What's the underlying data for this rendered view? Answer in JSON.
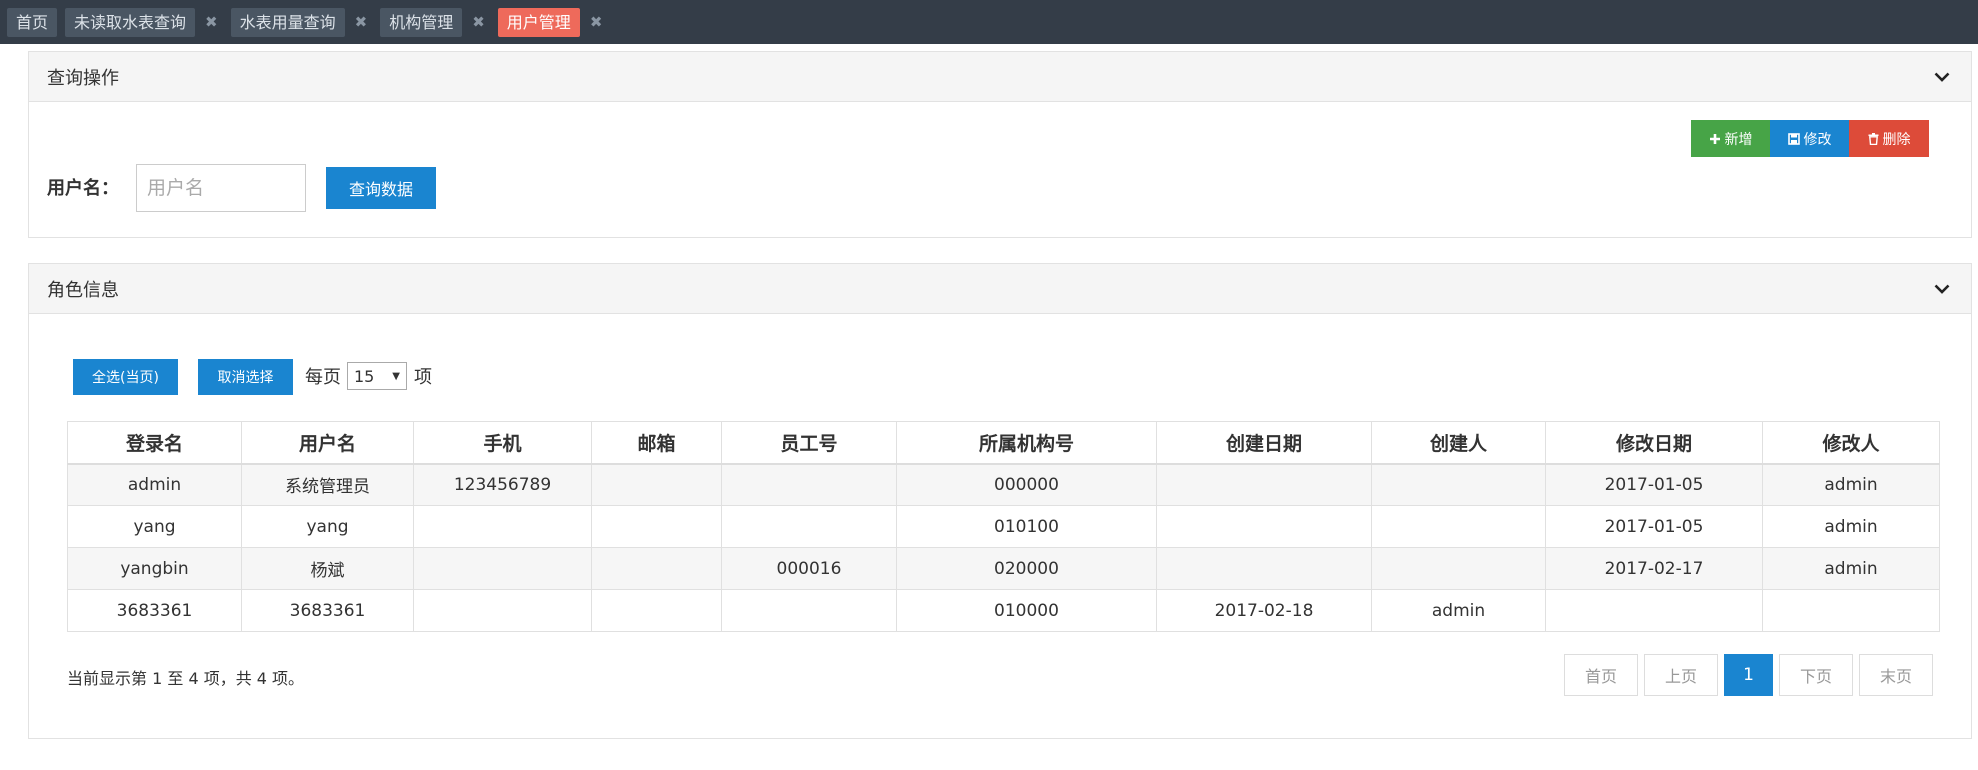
{
  "tabs": {
    "home": "首页",
    "items": [
      {
        "label": "未读取水表查询",
        "active": false
      },
      {
        "label": "水表用量查询",
        "active": false
      },
      {
        "label": "机构管理",
        "active": false
      },
      {
        "label": "用户管理",
        "active": true
      }
    ],
    "close_glyph": "✖"
  },
  "query_panel": {
    "title": "查询操作",
    "username_label": "用户名：",
    "username_placeholder": "用户名",
    "username_value": "",
    "query_button": "查询数据",
    "add_button": "新增",
    "edit_button": "修改",
    "delete_button": "删除"
  },
  "role_panel": {
    "title": "角色信息",
    "select_all_button": "全选(当页)",
    "cancel_select_button": "取消选择",
    "per_page_prefix": "每页",
    "per_page_value": "15",
    "per_page_suffix": "项",
    "summary": "当前显示第 1 至 4 项，共 4 项。"
  },
  "table": {
    "headers": [
      "登录名",
      "用户名",
      "手机",
      "邮箱",
      "员工号",
      "所属机构号",
      "创建日期",
      "创建人",
      "修改日期",
      "修改人"
    ],
    "rows": [
      [
        "admin",
        "系统管理员",
        "123456789",
        "",
        "",
        "000000",
        "",
        "",
        "2017-01-05",
        "admin"
      ],
      [
        "yang",
        "yang",
        "",
        "",
        "",
        "010100",
        "",
        "",
        "2017-01-05",
        "admin"
      ],
      [
        "yangbin",
        "杨斌",
        "",
        "",
        "000016",
        "020000",
        "",
        "",
        "2017-02-17",
        "admin"
      ],
      [
        "3683361",
        "3683361",
        "",
        "",
        "",
        "010000",
        "2017-02-18",
        "admin",
        "",
        ""
      ]
    ]
  },
  "pagination": {
    "first": "首页",
    "prev": "上页",
    "current": "1",
    "next": "下页",
    "last": "末页"
  },
  "colors": {
    "topbar": "#343d48",
    "active_tab": "#ee6a5b",
    "primary_blue": "#1a85d0",
    "add_green": "#47a447",
    "delete_red": "#dd4b39"
  }
}
